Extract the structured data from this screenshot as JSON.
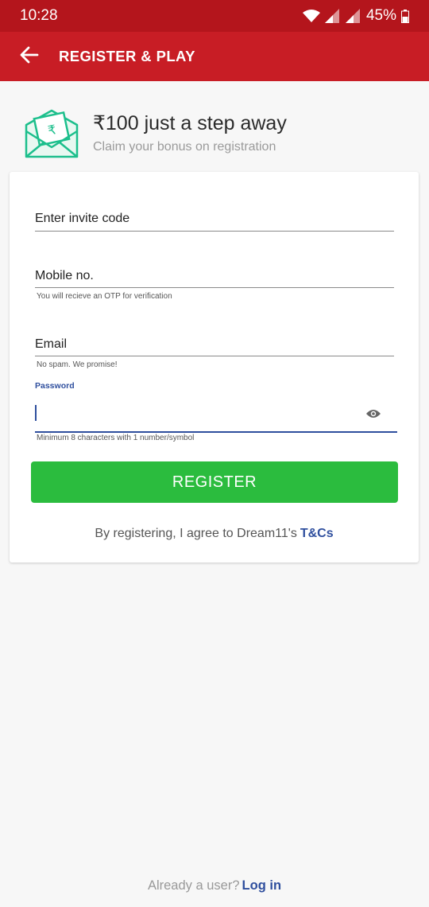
{
  "status_bar": {
    "time": "10:28",
    "battery": "45%"
  },
  "app_bar": {
    "title": "REGISTER & PLAY"
  },
  "promo": {
    "title": "₹100 just a step away",
    "subtitle": "Claim your bonus on registration"
  },
  "form": {
    "invite_label": "Enter invite code",
    "mobile_label": "Mobile no.",
    "mobile_helper": "You will recieve an OTP for verification",
    "email_label": "Email",
    "email_helper": "No spam. We promise!",
    "password_label": "Password",
    "password_value": "",
    "password_helper": "Minimum 8 characters with 1 number/symbol",
    "register_label": "REGISTER",
    "terms_text": "By registering, I agree to Dream11's",
    "terms_link": "T&Cs"
  },
  "footer": {
    "text": "Already a user?",
    "login_link": "Log in"
  },
  "colors": {
    "status_bar": "#b4151c",
    "app_bar": "#c81d25",
    "accent": "#2bbc3e",
    "link": "#2f4f9e",
    "icon": "#1cbf8c"
  },
  "icons": [
    "wifi-icon",
    "signal-icon",
    "battery-icon",
    "back-arrow-icon",
    "rupee-envelope-icon",
    "eye-icon"
  ]
}
